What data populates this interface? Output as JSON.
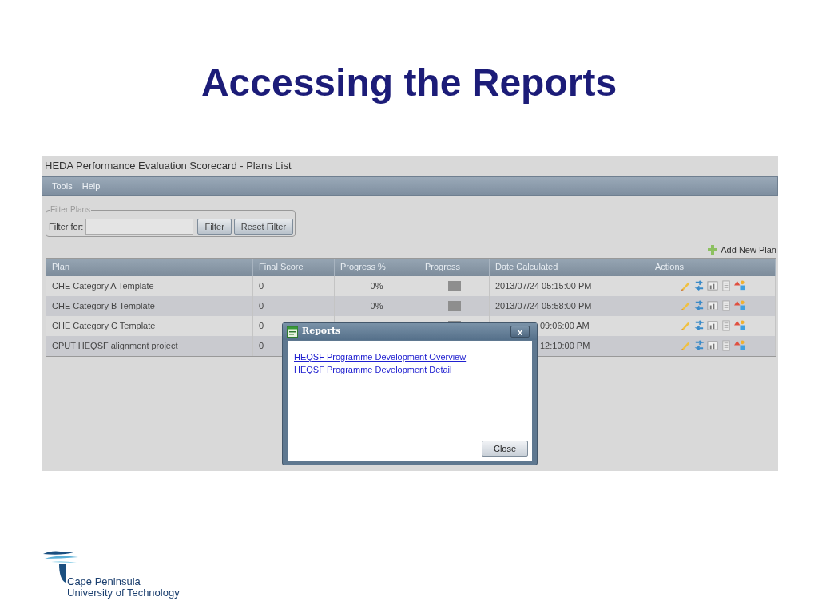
{
  "slide_title": "Accessing the Reports",
  "app": {
    "window_title": "HEDA Performance Evaluation Scorecard - Plans List",
    "menu": [
      "Tools",
      "Help"
    ],
    "filter": {
      "legend": "Filter Plans",
      "label": "Filter for:",
      "buttons": [
        "Filter",
        "Reset Filter"
      ]
    },
    "add_new": "Add New Plan",
    "table": {
      "columns": [
        "Plan",
        "Final Score",
        "Progress %",
        "Progress",
        "Date Calculated",
        "Actions"
      ],
      "rows": [
        {
          "kind": "full",
          "plan": "CHE Category A Template",
          "final_score": "0",
          "progress_pct": "0%",
          "level": 0,
          "date": "2013/07/24 05:15:00 PM"
        },
        {
          "kind": "full",
          "plan": "CHE Category B Template",
          "final_score": "0",
          "progress_pct": "0%",
          "level": 0,
          "date": "2013/07/24 05:58:00 PM"
        },
        {
          "kind": "behind_dialog",
          "plan": "CHE Category C Template",
          "final_score": "0",
          "level": 0,
          "date": "09:06:00 AM"
        },
        {
          "kind": "behind_dialog",
          "plan": "CPUT HEQSF alignment project",
          "final_score": "0",
          "date": "12:10:00 PM"
        }
      ]
    },
    "dialog": {
      "title": "Reports",
      "close_x": "x",
      "links": [
        "HEQSF Programme Development Overview",
        "HEQSF Programme Development Detail"
      ],
      "button": "Close"
    }
  },
  "logo": {
    "lines": [
      "Cape Peninsula",
      "University of Technology"
    ]
  }
}
